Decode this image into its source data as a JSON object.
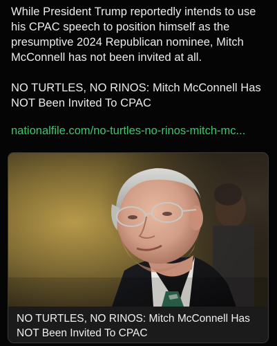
{
  "post": {
    "paragraph": "While President Trump reportedly intends to use his CPAC speech to position himself as the presumptive 2024 Republican nominee, Mitch McConnell has not been invited at all.",
    "headline_line1": "NO TURTLES, NO RINOS: Mitch McConnell Has",
    "headline_line2": "NOT Been Invited To CPAC",
    "link_text": "nationalfile.com/no-turtles-no-rinos-mitch-mc..."
  },
  "link_card": {
    "image_alt": "Mitch McConnell photo",
    "title": "NO TURTLES, NO RINOS: Mitch McConnell Has NOT Been Invited To CPAC"
  },
  "colors": {
    "background": "#050505",
    "text": "#ececec",
    "link": "#39c86a",
    "card_border": "#3a3a3a",
    "card_title_bg": "#1b1b1b"
  }
}
